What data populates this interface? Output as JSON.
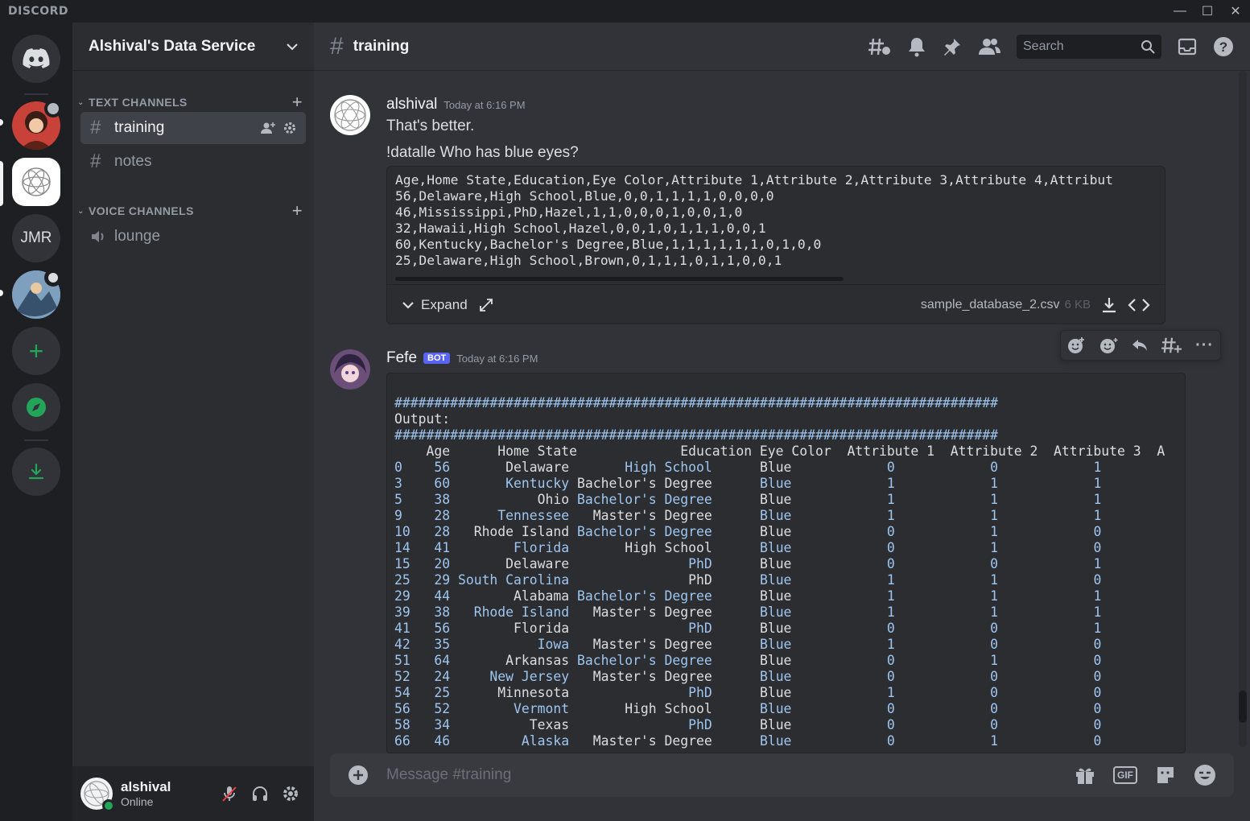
{
  "app": {
    "brand": "DISCORD"
  },
  "rail": {
    "dm_label": "Direct Messages",
    "jmr_label": "JMR"
  },
  "guild": {
    "name": "Alshival's Data Service"
  },
  "categories": {
    "text": "TEXT CHANNELS",
    "voice": "VOICE CHANNELS"
  },
  "channels": {
    "training": "training",
    "notes": "notes",
    "lounge": "lounge"
  },
  "user": {
    "name": "alshival",
    "status": "Online"
  },
  "header": {
    "channel": "training",
    "search_placeholder": "Search"
  },
  "messages": {
    "m1": {
      "author": "alshival",
      "time": "Today at 6:16 PM",
      "line1": "That's better.",
      "line2": "!datalle Who has blue eyes?"
    },
    "m2": {
      "author": "Fefe",
      "tag": "BOT",
      "time": "Today at 6:16 PM"
    }
  },
  "attachment": {
    "filename": "sample_database_2.csv",
    "size": "6 KB",
    "expand": "Expand",
    "lines": [
      "Age,Home State,Education,Eye Color,Attribute 1,Attribute 2,Attribute 3,Attribute 4,Attribut",
      "56,Delaware,High School,Blue,0,0,1,1,1,1,0,0,0,0",
      "46,Mississippi,PhD,Hazel,1,1,0,0,0,1,0,0,1,0",
      "32,Hawaii,High School,Hazel,0,0,1,0,1,1,1,0,0,1",
      "60,Kentucky,Bachelor's Degree,Blue,1,1,1,1,1,1,0,1,0,0",
      "25,Delaware,High School,Brown,0,1,1,1,0,1,1,0,0,1"
    ]
  },
  "output": {
    "rule": "############################################################################",
    "label": "Output:",
    "header": "    Age      Home State             Education Eye Color  Attribute 1  Attribute 2  Attribute 3  A",
    "rows": [
      [
        "0",
        "56",
        "Delaware",
        "High School",
        "Blue",
        "0",
        "0",
        "1"
      ],
      [
        "3",
        "60",
        "Kentucky",
        "Bachelor's Degree",
        "Blue",
        "1",
        "1",
        "1"
      ],
      [
        "5",
        "38",
        "Ohio",
        "Bachelor's Degree",
        "Blue",
        "1",
        "1",
        "1"
      ],
      [
        "9",
        "28",
        "Tennessee",
        "Master's Degree",
        "Blue",
        "1",
        "1",
        "1"
      ],
      [
        "10",
        "28",
        "Rhode Island",
        "Bachelor's Degree",
        "Blue",
        "0",
        "1",
        "0"
      ],
      [
        "14",
        "41",
        "Florida",
        "High School",
        "Blue",
        "0",
        "1",
        "0"
      ],
      [
        "15",
        "20",
        "Delaware",
        "PhD",
        "Blue",
        "0",
        "0",
        "1"
      ],
      [
        "25",
        "29",
        "South Carolina",
        "PhD",
        "Blue",
        "1",
        "1",
        "0"
      ],
      [
        "29",
        "44",
        "Alabama",
        "Bachelor's Degree",
        "Blue",
        "1",
        "1",
        "1"
      ],
      [
        "39",
        "38",
        "Rhode Island",
        "Master's Degree",
        "Blue",
        "1",
        "1",
        "1"
      ],
      [
        "41",
        "56",
        "Florida",
        "PhD",
        "Blue",
        "0",
        "0",
        "1"
      ],
      [
        "42",
        "35",
        "Iowa",
        "Master's Degree",
        "Blue",
        "1",
        "0",
        "0"
      ],
      [
        "51",
        "64",
        "Arkansas",
        "Bachelor's Degree",
        "Blue",
        "0",
        "1",
        "0"
      ],
      [
        "52",
        "24",
        "New Jersey",
        "Master's Degree",
        "Blue",
        "0",
        "0",
        "0"
      ],
      [
        "54",
        "25",
        "Minnesota",
        "PhD",
        "Blue",
        "1",
        "0",
        "0"
      ],
      [
        "56",
        "52",
        "Vermont",
        "High School",
        "Blue",
        "0",
        "0",
        "0"
      ],
      [
        "58",
        "34",
        "Texas",
        "PhD",
        "Blue",
        "0",
        "0",
        "0"
      ],
      [
        "66",
        "46",
        "Alaska",
        "Master's Degree",
        "Blue",
        "0",
        "1",
        "0"
      ]
    ]
  },
  "composer": {
    "placeholder": "Message #training"
  },
  "colors": {
    "accent": "#5865f2",
    "green": "#23a559",
    "online": "#23a559"
  },
  "icons": [
    "discord-logo-icon",
    "add-server-icon",
    "explore-icon",
    "download-icon",
    "threads-icon",
    "bell-icon",
    "pin-icon",
    "members-icon",
    "search-icon",
    "inbox-icon",
    "help-icon",
    "gift-icon",
    "gif-icon",
    "sticker-icon",
    "emoji-icon"
  ]
}
